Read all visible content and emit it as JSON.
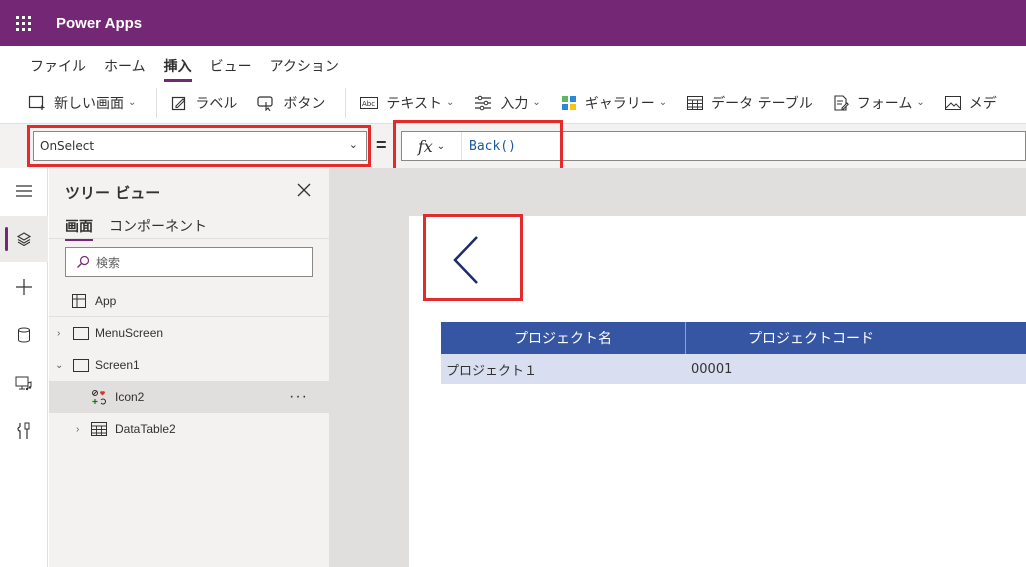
{
  "app": {
    "name": "Power Apps"
  },
  "menu": {
    "tabs": [
      "ファイル",
      "ホーム",
      "挿入",
      "ビュー",
      "アクション"
    ],
    "active_index": 2
  },
  "ribbon": {
    "new_screen": "新しい画面",
    "label": "ラベル",
    "button": "ボタン",
    "text": "テキスト",
    "input": "入力",
    "gallery": "ギャラリー",
    "data_table": "データ テーブル",
    "form": "フォーム",
    "media": "メデ"
  },
  "formula_bar": {
    "property": "OnSelect",
    "equals": "=",
    "fx_label": "fx",
    "formula": "Back()"
  },
  "tree_view": {
    "title": "ツリー ビュー",
    "tabs": [
      "画面",
      "コンポーネント"
    ],
    "search_placeholder": "検索",
    "items": {
      "app": "App",
      "menu_screen": "MenuScreen",
      "screen1": "Screen1",
      "icon2": "Icon2",
      "more": "···",
      "data_table2": "DataTable2"
    }
  },
  "canvas": {
    "table": {
      "headers": [
        "プロジェクト名",
        "プロジェクトコード"
      ],
      "rows": [
        [
          "プロジェクト１",
          "00001"
        ]
      ]
    }
  },
  "colors": {
    "brand": "#742774",
    "highlight": "#e32b2b",
    "table_header": "#3656a4",
    "table_row": "#d9dff0"
  }
}
